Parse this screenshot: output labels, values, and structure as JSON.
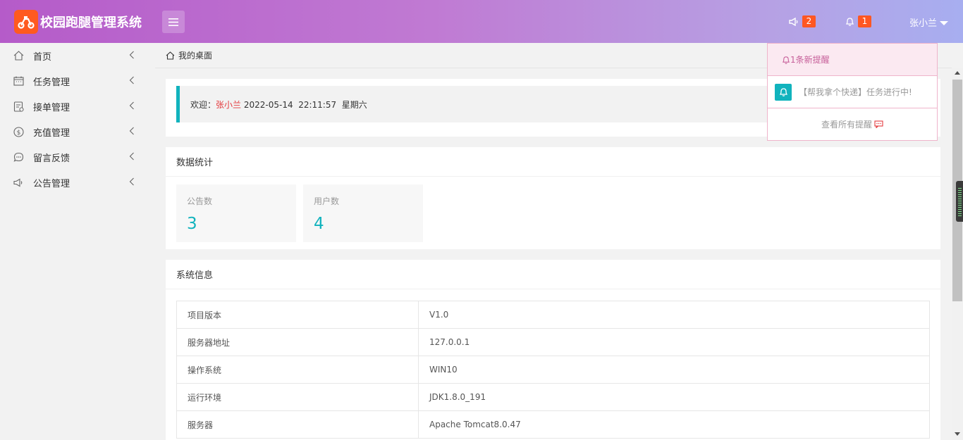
{
  "app": {
    "title": "校园跑腿管理系统"
  },
  "header": {
    "announcement_count": "2",
    "notification_count": "1",
    "user_name": "张小兰"
  },
  "sidebar": {
    "items": [
      {
        "label": "首页",
        "icon": "home-icon"
      },
      {
        "label": "任务管理",
        "icon": "calendar-icon"
      },
      {
        "label": "接单管理",
        "icon": "order-icon"
      },
      {
        "label": "充值管理",
        "icon": "dollar-icon"
      },
      {
        "label": "留言反馈",
        "icon": "chat-icon"
      },
      {
        "label": "公告管理",
        "icon": "megaphone-icon"
      }
    ]
  },
  "breadcrumb": {
    "label": "我的桌面"
  },
  "welcome": {
    "prefix": "欢迎：",
    "name": "张小兰",
    "datetime": " 2022-05-14  22:11:57  星期六"
  },
  "stats": {
    "title": "数据统计",
    "items": [
      {
        "label": "公告数",
        "value": "3"
      },
      {
        "label": "用户数",
        "value": "4"
      }
    ]
  },
  "sysinfo": {
    "title": "系统信息",
    "rows": [
      {
        "key": "项目版本",
        "value": "V1.0"
      },
      {
        "key": "服务器地址",
        "value": "127.0.0.1"
      },
      {
        "key": "操作系统",
        "value": "WIN10"
      },
      {
        "key": "运行环境",
        "value": "JDK1.8.0_191"
      },
      {
        "key": "服务器",
        "value": "Apache Tomcat8.0.47"
      }
    ]
  },
  "notifications": {
    "header": "1条新提醒",
    "items": [
      {
        "text": "【帮我拿个快递】任务进行中!"
      }
    ],
    "footer": "查看所有提醒"
  },
  "colors": {
    "accent": "#11b3bd",
    "badge": "#ff5722",
    "welcome_name": "#e4393c",
    "logo_bg": "#ff5a1f"
  }
}
